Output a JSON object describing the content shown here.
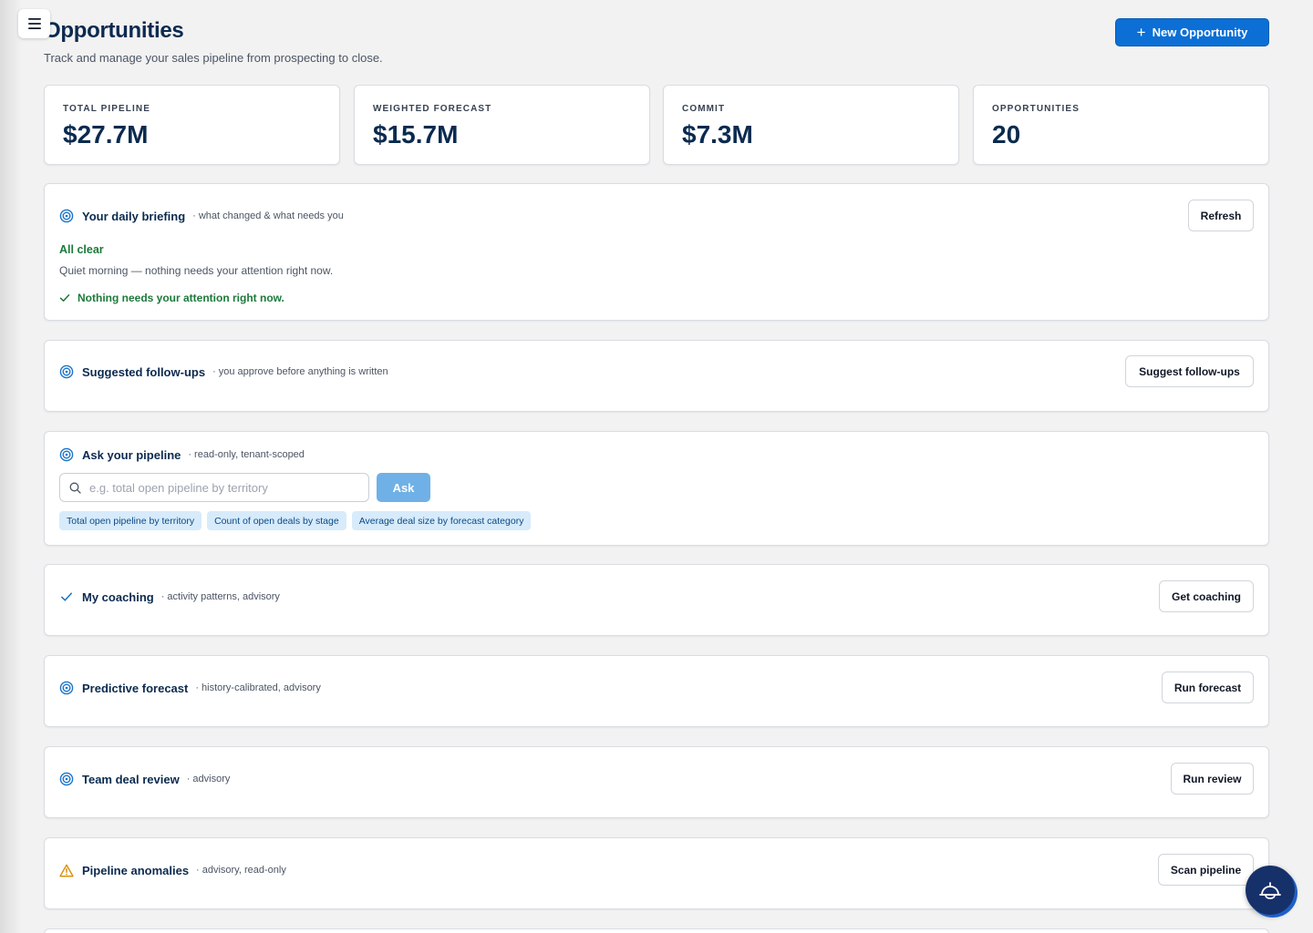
{
  "header": {
    "title": "Opportunities",
    "subtitle": "Track and manage your sales pipeline from prospecting to close.",
    "new_button_label": "New Opportunity",
    "menu_icon": "hamburger-icon"
  },
  "kpis": [
    {
      "label": "TOTAL PIPELINE",
      "value": "$27.7M"
    },
    {
      "label": "WEIGHTED FORECAST",
      "value": "$15.7M"
    },
    {
      "label": "COMMIT",
      "value": "$7.3M"
    },
    {
      "label": "OPPORTUNITIES",
      "value": "20"
    }
  ],
  "briefing": {
    "title": "Your daily briefing",
    "sep": "·",
    "desc": "what changed & what needs you",
    "button": "Refresh",
    "status": "All clear",
    "message": "Quiet morning — nothing needs your attention right now.",
    "check_text": "Nothing needs your attention right now."
  },
  "followups": {
    "title": "Suggested follow-ups",
    "sep": "·",
    "desc": "you approve before anything is written",
    "button": "Suggest follow-ups"
  },
  "ask": {
    "title": "Ask your pipeline",
    "sep": "·",
    "desc": "read-only, tenant-scoped",
    "placeholder": "e.g. total open pipeline by territory",
    "value": "",
    "button": "Ask",
    "chips": [
      "Total open pipeline by territory",
      "Count of open deals by stage",
      "Average deal size by forecast category"
    ]
  },
  "coaching": {
    "title": "My coaching",
    "sep": "·",
    "desc": "activity patterns, advisory",
    "button": "Get coaching"
  },
  "forecast": {
    "title": "Predictive forecast",
    "sep": "·",
    "desc": "history-calibrated, advisory",
    "button": "Run forecast"
  },
  "review": {
    "title": "Team deal review",
    "sep": "·",
    "desc": "advisory",
    "button": "Run review"
  },
  "anomalies": {
    "title": "Pipeline anomalies",
    "sep": "·",
    "desc": "advisory, read-only",
    "button": "Scan pipeline"
  },
  "colors": {
    "primary": "#0b6fd6",
    "navy": "#0b2a4f",
    "success": "#1c7a3a",
    "warning": "#d98c00",
    "chip_bg": "#d7ebfb"
  }
}
